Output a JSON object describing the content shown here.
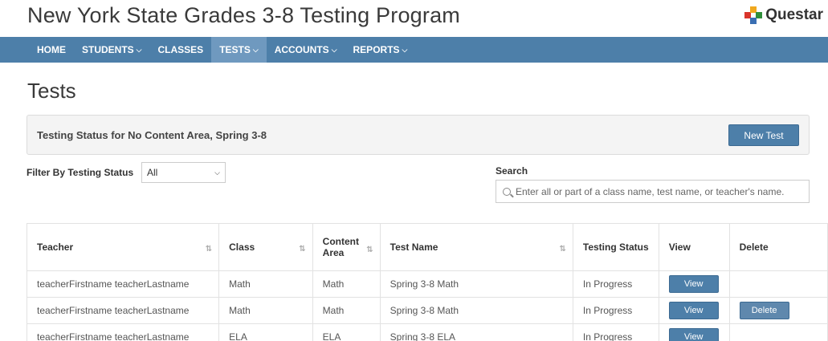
{
  "header": {
    "title": "New York State Grades 3-8 Testing Program",
    "logo_text": "Questar"
  },
  "nav": {
    "items": [
      {
        "label": "HOME",
        "chevron": false,
        "active": false
      },
      {
        "label": "STUDENTS",
        "chevron": true,
        "active": false
      },
      {
        "label": "CLASSES",
        "chevron": false,
        "active": false
      },
      {
        "label": "TESTS",
        "chevron": true,
        "active": true
      },
      {
        "label": "ACCOUNTS",
        "chevron": true,
        "active": false
      },
      {
        "label": "REPORTS",
        "chevron": true,
        "active": false
      }
    ]
  },
  "page": {
    "title": "Tests"
  },
  "status_panel": {
    "text": "Testing Status for No Content Area, Spring 3-8",
    "new_test_label": "New Test"
  },
  "filter": {
    "label": "Filter By Testing Status",
    "selected": "All"
  },
  "search": {
    "label": "Search",
    "placeholder": "Enter all or part of a class name, test name, or teacher's name."
  },
  "table": {
    "columns": [
      "Teacher",
      "Class",
      "Content Area",
      "Test Name",
      "Testing Status",
      "View",
      "Delete"
    ],
    "rows": [
      {
        "teacher": "teacherFirstname teacherLastname",
        "class": "Math",
        "content_area": "Math",
        "test_name": "Spring 3-8 Math",
        "status": "In Progress",
        "view": "View",
        "delete": ""
      },
      {
        "teacher": "teacherFirstname teacherLastname",
        "class": "Math",
        "content_area": "Math",
        "test_name": "Spring 3-8 Math",
        "status": "In Progress",
        "view": "View",
        "delete": "Delete"
      },
      {
        "teacher": "teacherFirstname teacherLastname",
        "class": "ELA",
        "content_area": "ELA",
        "test_name": "Spring 3-8 ELA",
        "status": "In Progress",
        "view": "View",
        "delete": ""
      }
    ]
  },
  "colors": {
    "nav_bg": "#4d7fa9",
    "nav_active": "#6f99bf",
    "button": "#4d7fa9"
  }
}
